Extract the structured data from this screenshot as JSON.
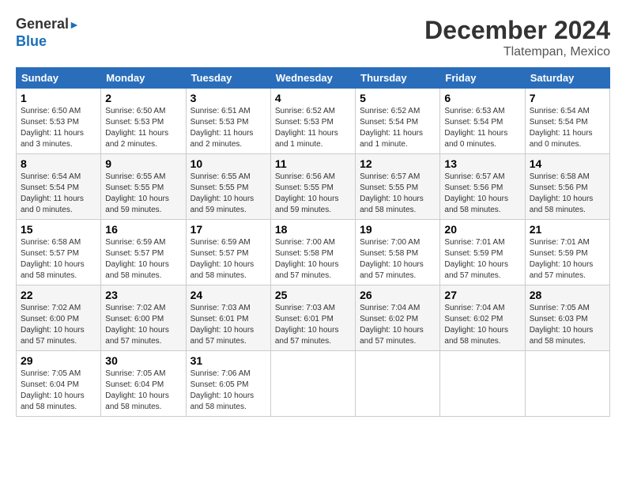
{
  "header": {
    "logo_line1": "General",
    "logo_line2": "Blue",
    "month": "December 2024",
    "location": "Tlatempan, Mexico"
  },
  "weekdays": [
    "Sunday",
    "Monday",
    "Tuesday",
    "Wednesday",
    "Thursday",
    "Friday",
    "Saturday"
  ],
  "weeks": [
    [
      {
        "day": "1",
        "sunrise": "6:50 AM",
        "sunset": "5:53 PM",
        "daylight": "11 hours and 3 minutes."
      },
      {
        "day": "2",
        "sunrise": "6:50 AM",
        "sunset": "5:53 PM",
        "daylight": "11 hours and 2 minutes."
      },
      {
        "day": "3",
        "sunrise": "6:51 AM",
        "sunset": "5:53 PM",
        "daylight": "11 hours and 2 minutes."
      },
      {
        "day": "4",
        "sunrise": "6:52 AM",
        "sunset": "5:53 PM",
        "daylight": "11 hours and 1 minute."
      },
      {
        "day": "5",
        "sunrise": "6:52 AM",
        "sunset": "5:54 PM",
        "daylight": "11 hours and 1 minute."
      },
      {
        "day": "6",
        "sunrise": "6:53 AM",
        "sunset": "5:54 PM",
        "daylight": "11 hours and 0 minutes."
      },
      {
        "day": "7",
        "sunrise": "6:54 AM",
        "sunset": "5:54 PM",
        "daylight": "11 hours and 0 minutes."
      }
    ],
    [
      {
        "day": "8",
        "sunrise": "6:54 AM",
        "sunset": "5:54 PM",
        "daylight": "11 hours and 0 minutes."
      },
      {
        "day": "9",
        "sunrise": "6:55 AM",
        "sunset": "5:55 PM",
        "daylight": "10 hours and 59 minutes."
      },
      {
        "day": "10",
        "sunrise": "6:55 AM",
        "sunset": "5:55 PM",
        "daylight": "10 hours and 59 minutes."
      },
      {
        "day": "11",
        "sunrise": "6:56 AM",
        "sunset": "5:55 PM",
        "daylight": "10 hours and 59 minutes."
      },
      {
        "day": "12",
        "sunrise": "6:57 AM",
        "sunset": "5:55 PM",
        "daylight": "10 hours and 58 minutes."
      },
      {
        "day": "13",
        "sunrise": "6:57 AM",
        "sunset": "5:56 PM",
        "daylight": "10 hours and 58 minutes."
      },
      {
        "day": "14",
        "sunrise": "6:58 AM",
        "sunset": "5:56 PM",
        "daylight": "10 hours and 58 minutes."
      }
    ],
    [
      {
        "day": "15",
        "sunrise": "6:58 AM",
        "sunset": "5:57 PM",
        "daylight": "10 hours and 58 minutes."
      },
      {
        "day": "16",
        "sunrise": "6:59 AM",
        "sunset": "5:57 PM",
        "daylight": "10 hours and 58 minutes."
      },
      {
        "day": "17",
        "sunrise": "6:59 AM",
        "sunset": "5:57 PM",
        "daylight": "10 hours and 58 minutes."
      },
      {
        "day": "18",
        "sunrise": "7:00 AM",
        "sunset": "5:58 PM",
        "daylight": "10 hours and 57 minutes."
      },
      {
        "day": "19",
        "sunrise": "7:00 AM",
        "sunset": "5:58 PM",
        "daylight": "10 hours and 57 minutes."
      },
      {
        "day": "20",
        "sunrise": "7:01 AM",
        "sunset": "5:59 PM",
        "daylight": "10 hours and 57 minutes."
      },
      {
        "day": "21",
        "sunrise": "7:01 AM",
        "sunset": "5:59 PM",
        "daylight": "10 hours and 57 minutes."
      }
    ],
    [
      {
        "day": "22",
        "sunrise": "7:02 AM",
        "sunset": "6:00 PM",
        "daylight": "10 hours and 57 minutes."
      },
      {
        "day": "23",
        "sunrise": "7:02 AM",
        "sunset": "6:00 PM",
        "daylight": "10 hours and 57 minutes."
      },
      {
        "day": "24",
        "sunrise": "7:03 AM",
        "sunset": "6:01 PM",
        "daylight": "10 hours and 57 minutes."
      },
      {
        "day": "25",
        "sunrise": "7:03 AM",
        "sunset": "6:01 PM",
        "daylight": "10 hours and 57 minutes."
      },
      {
        "day": "26",
        "sunrise": "7:04 AM",
        "sunset": "6:02 PM",
        "daylight": "10 hours and 57 minutes."
      },
      {
        "day": "27",
        "sunrise": "7:04 AM",
        "sunset": "6:02 PM",
        "daylight": "10 hours and 58 minutes."
      },
      {
        "day": "28",
        "sunrise": "7:05 AM",
        "sunset": "6:03 PM",
        "daylight": "10 hours and 58 minutes."
      }
    ],
    [
      {
        "day": "29",
        "sunrise": "7:05 AM",
        "sunset": "6:04 PM",
        "daylight": "10 hours and 58 minutes."
      },
      {
        "day": "30",
        "sunrise": "7:05 AM",
        "sunset": "6:04 PM",
        "daylight": "10 hours and 58 minutes."
      },
      {
        "day": "31",
        "sunrise": "7:06 AM",
        "sunset": "6:05 PM",
        "daylight": "10 hours and 58 minutes."
      },
      null,
      null,
      null,
      null
    ]
  ]
}
